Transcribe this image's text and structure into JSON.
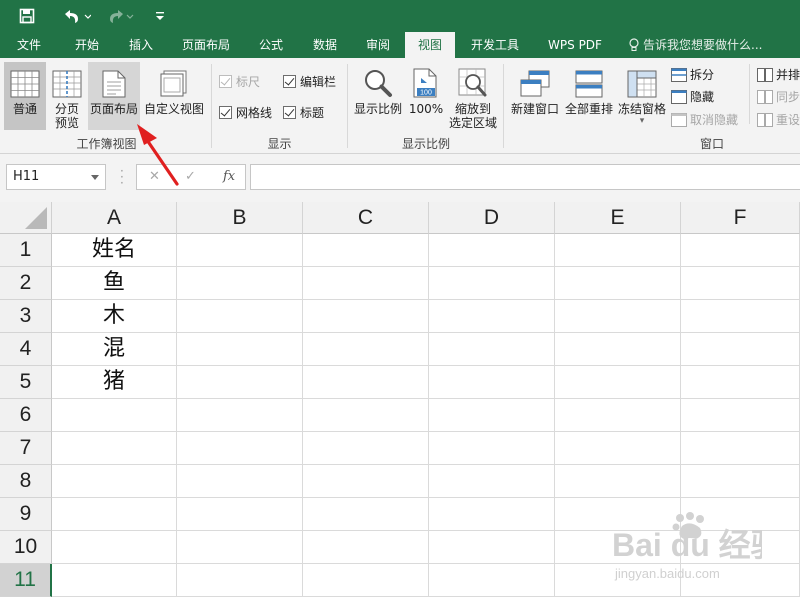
{
  "tabs": [
    {
      "label": "文件"
    },
    {
      "label": "开始"
    },
    {
      "label": "插入"
    },
    {
      "label": "页面布局"
    },
    {
      "label": "公式"
    },
    {
      "label": "数据"
    },
    {
      "label": "审阅"
    },
    {
      "label": "视图",
      "active": true
    },
    {
      "label": "开发工具"
    },
    {
      "label": "WPS PDF"
    }
  ],
  "tell_me": "告诉我您想要做什么...",
  "ribbon": {
    "workbook_views": {
      "label": "工作簿视图",
      "normal": "普通",
      "page_break_line1": "分页",
      "page_break_line2": "预览",
      "page_layout": "页面布局",
      "custom_views": "自定义视图"
    },
    "show": {
      "label": "显示",
      "ruler": "标尺",
      "formula_bar": "编辑栏",
      "gridlines": "网格线",
      "headings": "标题"
    },
    "zoom": {
      "label": "显示比例",
      "zoom": "显示比例",
      "zoom_100": "100%",
      "zoom_icon_badge": "100",
      "zoom_selection_line1": "缩放到",
      "zoom_selection_line2": "选定区域"
    },
    "window": {
      "label": "窗口",
      "new_window": "新建窗口",
      "arrange_all": "全部重排",
      "freeze_panes": "冻结窗格",
      "split": "拆分",
      "hide": "隐藏",
      "unhide": "取消隐藏",
      "side_by_side": "并排",
      "sync_scroll": "同步",
      "reset_position": "重设"
    }
  },
  "formula_bar": {
    "name_box": "H11",
    "fx": "fx",
    "value": ""
  },
  "columns": [
    "A",
    "B",
    "C",
    "D",
    "E",
    "F"
  ],
  "rows": [
    "1",
    "2",
    "3",
    "4",
    "5",
    "6",
    "7",
    "8",
    "9",
    "10",
    "11"
  ],
  "cells_col_a": [
    "姓名",
    "鱼",
    "木",
    "混",
    "猪",
    "",
    "",
    "",
    "",
    "",
    ""
  ],
  "active_row": "11",
  "watermark": {
    "main": "Bai du 经验",
    "sub": "jingyan.baidu.com"
  },
  "colors": {
    "accent": "#217346",
    "arrow": "#e02020"
  }
}
